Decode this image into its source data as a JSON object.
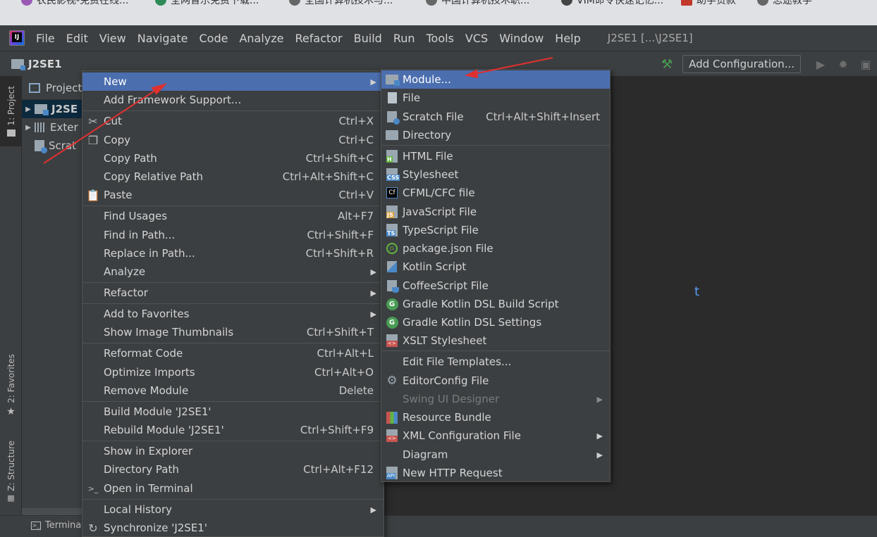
{
  "browser_tabs": [
    {
      "label": "农民影视-免费在线..."
    },
    {
      "label": "全网音乐免费下载..."
    },
    {
      "label": "全国计算机技术与..."
    },
    {
      "label": "中国计算机技术职..."
    },
    {
      "label": "VIM命令快速记忆..."
    },
    {
      "label": "助学贷款"
    },
    {
      "label": "思途教学"
    }
  ],
  "menubar": {
    "items": [
      "File",
      "Edit",
      "View",
      "Navigate",
      "Code",
      "Analyze",
      "Refactor",
      "Build",
      "Run",
      "Tools",
      "VCS",
      "Window",
      "Help"
    ],
    "window_title": "J2SE1 [...\\J2SE1]"
  },
  "navbar": {
    "project": "J2SE1",
    "add_configuration": "Add Configuration..."
  },
  "left_strip": {
    "project_tab": "1: Project",
    "favorites_tab": "2: Favorites",
    "structure_tab": "Z: Structure"
  },
  "project_panel": {
    "title": "Project",
    "tree": [
      "J2SE",
      "Exter",
      "Scrat"
    ]
  },
  "editor": {
    "fragment": "t"
  },
  "bottom": {
    "terminal": "Terminal"
  },
  "context_menu": [
    {
      "label": "New",
      "shortcut": "",
      "submenu": true
    },
    {
      "label": "Add Framework Support...",
      "shortcut": ""
    },
    {
      "label": "Cut",
      "shortcut": "Ctrl+X"
    },
    {
      "label": "Copy",
      "shortcut": "Ctrl+C"
    },
    {
      "label": "Copy Path",
      "shortcut": "Ctrl+Shift+C"
    },
    {
      "label": "Copy Relative Path",
      "shortcut": "Ctrl+Alt+Shift+C"
    },
    {
      "label": "Paste",
      "shortcut": "Ctrl+V"
    },
    {
      "label": "Find Usages",
      "shortcut": "Alt+F7"
    },
    {
      "label": "Find in Path...",
      "shortcut": "Ctrl+Shift+F"
    },
    {
      "label": "Replace in Path...",
      "shortcut": "Ctrl+Shift+R"
    },
    {
      "label": "Analyze",
      "shortcut": "",
      "submenu": true
    },
    {
      "label": "Refactor",
      "shortcut": "",
      "submenu": true
    },
    {
      "label": "Add to Favorites",
      "shortcut": "",
      "submenu": true
    },
    {
      "label": "Show Image Thumbnails",
      "shortcut": "Ctrl+Shift+T"
    },
    {
      "label": "Reformat Code",
      "shortcut": "Ctrl+Alt+L"
    },
    {
      "label": "Optimize Imports",
      "shortcut": "Ctrl+Alt+O"
    },
    {
      "label": "Remove Module",
      "shortcut": "Delete"
    },
    {
      "label": "Build Module 'J2SE1'",
      "shortcut": ""
    },
    {
      "label": "Rebuild Module 'J2SE1'",
      "shortcut": "Ctrl+Shift+F9"
    },
    {
      "label": "Show in Explorer",
      "shortcut": ""
    },
    {
      "label": "Directory Path",
      "shortcut": "Ctrl+Alt+F12"
    },
    {
      "label": "Open in Terminal",
      "shortcut": ""
    },
    {
      "label": "Local History",
      "shortcut": "",
      "submenu": true
    },
    {
      "label": "Synchronize 'J2SE1'",
      "shortcut": ""
    }
  ],
  "new_submenu": [
    {
      "label": "Module...",
      "shortcut": ""
    },
    {
      "label": "File",
      "shortcut": ""
    },
    {
      "label": "Scratch File",
      "shortcut": "Ctrl+Alt+Shift+Insert"
    },
    {
      "label": "Directory",
      "shortcut": ""
    },
    {
      "label": "HTML File",
      "shortcut": ""
    },
    {
      "label": "Stylesheet",
      "shortcut": ""
    },
    {
      "label": "CFML/CFC file",
      "shortcut": ""
    },
    {
      "label": "JavaScript File",
      "shortcut": ""
    },
    {
      "label": "TypeScript File",
      "shortcut": ""
    },
    {
      "label": "package.json File",
      "shortcut": ""
    },
    {
      "label": "Kotlin Script",
      "shortcut": ""
    },
    {
      "label": "CoffeeScript File",
      "shortcut": ""
    },
    {
      "label": "Gradle Kotlin DSL Build Script",
      "shortcut": ""
    },
    {
      "label": "Gradle Kotlin DSL Settings",
      "shortcut": ""
    },
    {
      "label": "XSLT Stylesheet",
      "shortcut": ""
    },
    {
      "label": "Edit File Templates...",
      "shortcut": ""
    },
    {
      "label": "EditorConfig File",
      "shortcut": ""
    },
    {
      "label": "Swing UI Designer",
      "shortcut": "",
      "submenu": true
    },
    {
      "label": "Resource Bundle",
      "shortcut": ""
    },
    {
      "label": "XML Configuration File",
      "shortcut": "",
      "submenu": true
    },
    {
      "label": "Diagram",
      "shortcut": "",
      "submenu": true
    },
    {
      "label": "New HTTP Request",
      "shortcut": ""
    }
  ],
  "icon_labels": {
    "html": "H",
    "css": "CSS",
    "cfml": "Cf",
    "js": "JS",
    "ts": "TS",
    "pkg": "JS",
    "gradle": "G",
    "xml": "<>",
    "api": "API"
  },
  "colors": {
    "highlight": "#4b6eaf",
    "menu_bg": "#3c3f41",
    "annotation": "#e03030"
  }
}
